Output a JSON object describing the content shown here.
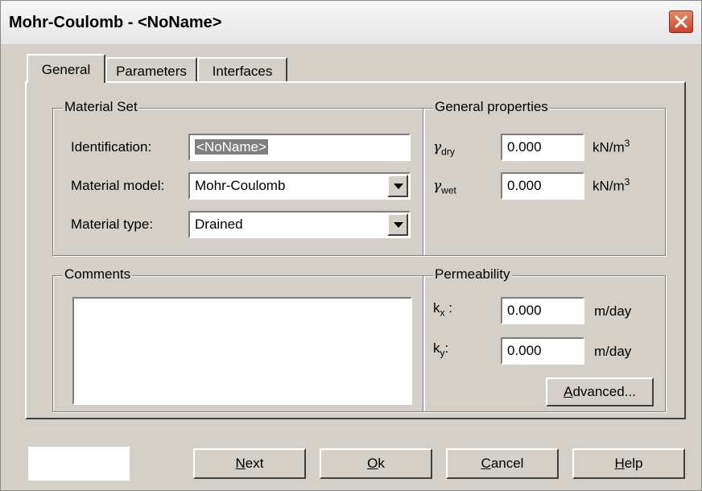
{
  "window": {
    "title": "Mohr-Coulomb - <NoName>"
  },
  "tabs": [
    {
      "label": "General"
    },
    {
      "label": "Parameters"
    },
    {
      "label": "Interfaces"
    }
  ],
  "material_set": {
    "legend": "Material Set",
    "identification_label": "Identification:",
    "identification_value": "<NoName>",
    "model_label": "Material model:",
    "model_value": "Mohr-Coulomb",
    "type_label": "Material type:",
    "type_value": "Drained"
  },
  "comments": {
    "legend": "Comments"
  },
  "general_properties": {
    "legend": "General properties",
    "gamma_dry": {
      "symbol": "γ",
      "subscript": "dry",
      "value": "0.000",
      "unit": "kN/m",
      "unit_sup": "3"
    },
    "gamma_wet": {
      "symbol": "γ",
      "subscript": "wet",
      "value": "0.000",
      "unit": "kN/m",
      "unit_sup": "3"
    }
  },
  "permeability": {
    "legend": "Permeability",
    "kx": {
      "symbol": "k",
      "subscript": "x",
      "suffix": " :",
      "value": "0.000",
      "unit": "m/day"
    },
    "ky": {
      "symbol": "k",
      "subscript": "y",
      "suffix": ":",
      "value": "0.000",
      "unit": "m/day"
    },
    "advanced_prefix": "A",
    "advanced_rest": "dvanced..."
  },
  "buttons": {
    "next_prefix": "N",
    "next_rest": "ext",
    "ok_prefix": "O",
    "ok_rest": "k",
    "cancel_prefix": "C",
    "cancel_rest": "ancel",
    "help_prefix": "H",
    "help_rest": "elp"
  },
  "colors": {
    "close_button": "#c8452c",
    "dialog_bg": "#d4d0c8"
  }
}
